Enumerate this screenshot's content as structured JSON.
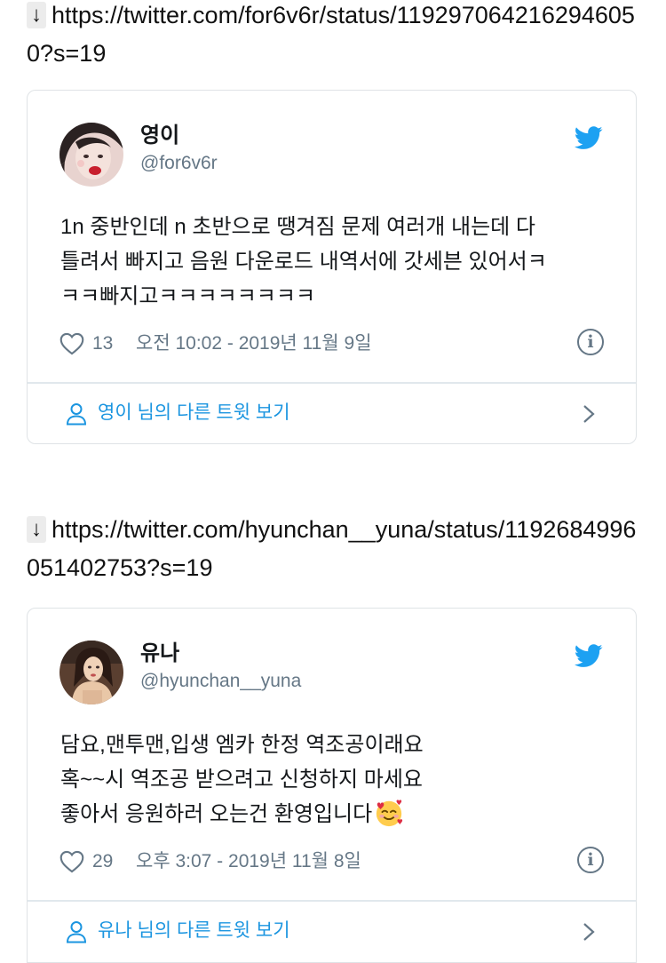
{
  "entries": [
    {
      "link_arrow": "↓",
      "url": "https://twitter.com/for6v6r/status/1192970642162946050?s=19",
      "tweet": {
        "author_name": "영이",
        "author_handle": "@for6v6r",
        "text_lines": [
          "1n 중반인데 n 초반으로 땡겨짐 문제 여러개 내는데 다",
          "틀려서 빠지고 음원 다운로드 내역서에 갓세븐 있어서ㅋ",
          "ㅋㅋ빠지고ㅋㅋㅋㅋㅋㅋㅋㅋ"
        ],
        "likes": "13",
        "timestamp": "오전 10:02 - 2019년 11월 9일",
        "info_icon": "i",
        "footer_label": "영이 님의 다른 트윗 보기"
      }
    },
    {
      "link_arrow": "↓",
      "url": "https://twitter.com/hyunchan__yuna/status/1192684996051402753?s=19",
      "tweet": {
        "author_name": "유나",
        "author_handle": "@hyunchan__yuna",
        "text_lines": [
          "담요,맨투맨,입생 엠카 한정 역조공이래요",
          "혹~~시 역조공 받으려고 신청하지 마세요",
          "좋아서 응원하러 오는건 환영입니다"
        ],
        "likes": "29",
        "timestamp": "오후 3:07 - 2019년 11월 8일",
        "info_icon": "i",
        "footer_label": "유나 님의 다른 트윗 보기"
      }
    }
  ],
  "icons": {
    "twitter_bird": "twitter-bird-icon",
    "heart": "heart-icon",
    "info": "info-icon",
    "person": "person-icon",
    "chevron": "chevron-right-icon",
    "emoji": "smiling-face-with-hearts-emoji"
  },
  "colors": {
    "twitter_blue": "#1da1f2",
    "link_blue": "#1b95e0",
    "meta_gray": "#657786",
    "border": "#dfe3e6"
  }
}
